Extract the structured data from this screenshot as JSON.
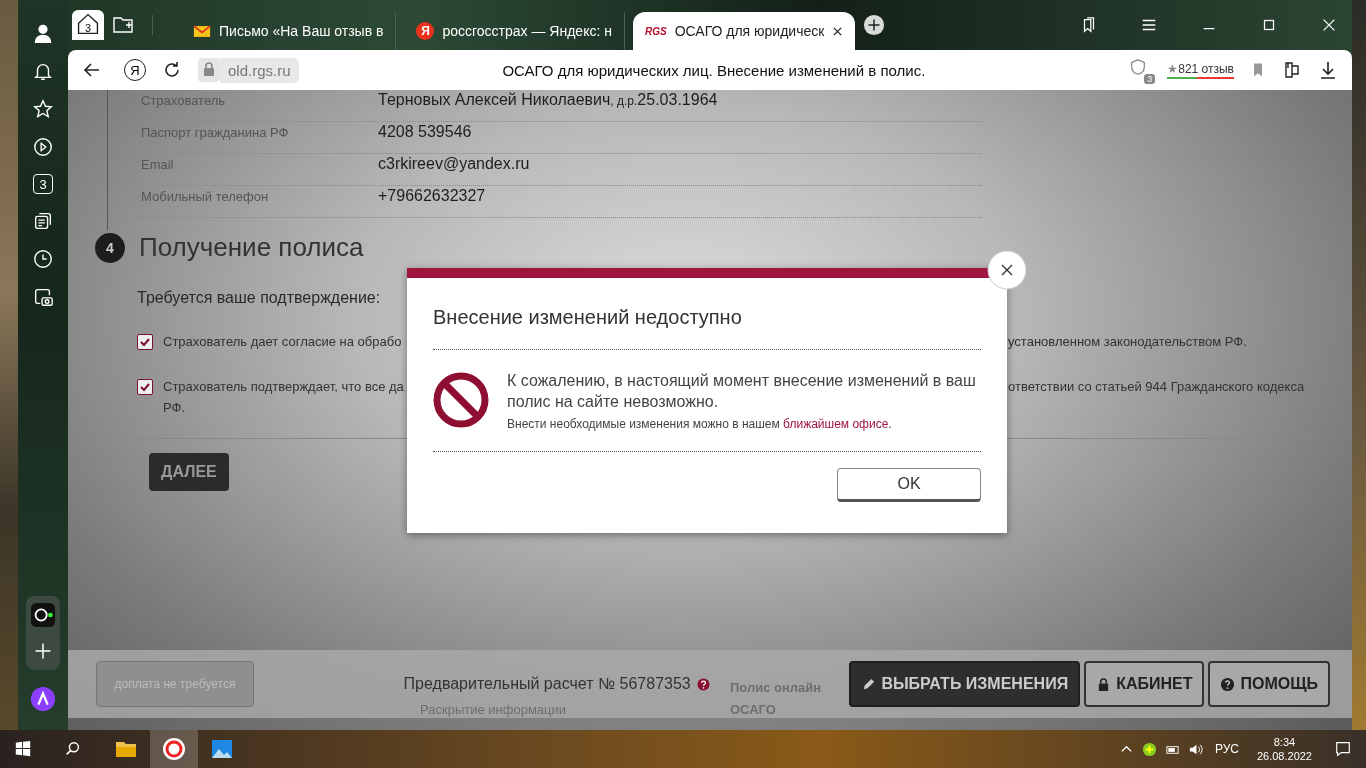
{
  "browser": {
    "home_badge": "3",
    "tabs": [
      {
        "kind": "mail",
        "label": "Письмо «На Ваш отзыв в",
        "selected": false
      },
      {
        "kind": "yandex",
        "icon_text": "Я",
        "label": "россгосстрах — Яндекс: н",
        "selected": false
      },
      {
        "kind": "rgs",
        "icon_text": "RGS",
        "label": "ОСАГО для юридическ",
        "selected": true
      }
    ],
    "yandex_button": "Я",
    "address": "old.rgs.ru",
    "page_title": "ОСАГО для юридических лиц. Внесение изменений в полис.",
    "shield_badge": "3",
    "reviews_star": "★",
    "reviews": "821 отзыв"
  },
  "sidebar": {
    "counter": "3"
  },
  "page": {
    "rows": [
      {
        "label": "Страхователь",
        "value": "Терновых Алексей Николаевич",
        "extra": ", д.р.",
        "extra_value": "25.03.1964"
      },
      {
        "label": "Паспорт гражданина РФ",
        "value": "4208 539546"
      },
      {
        "label": "Email",
        "value": "c3rkireev@yandex.ru"
      },
      {
        "label": "Мобильный телефон",
        "value": "+79662632327"
      }
    ],
    "section": {
      "number": "4",
      "title": "Получение полиса"
    },
    "confirm_prompt": "Требуется ваше подтверждение:",
    "checks": [
      {
        "checked": true,
        "text_start": "Страхователь дает согласие на обрабо",
        "text_end": "установленном законодательством РФ."
      },
      {
        "checked": true,
        "text_start": "Страхователь подтверждает, что все да",
        "text_end": "ответствии со статьей 944 Гражданского кодекса",
        "text_continued": "РФ."
      }
    ],
    "next_button": "ДАЛЕЕ",
    "footer": [
      {
        "text": "Раскрытие информации"
      },
      {
        "text": "Полис онлайн"
      },
      {
        "text": "ОСАГО"
      }
    ]
  },
  "bottom_bar": {
    "surcharge": "доплата не требуется",
    "estimate": "Предварительный расчет № 56787353",
    "buttons": [
      {
        "kind": "pencil",
        "label": "ВЫБРАТЬ ИЗМЕНЕНИЯ"
      },
      {
        "kind": "lock",
        "label": "КАБИНЕТ"
      },
      {
        "kind": "help",
        "label": "ПОМОЩЬ"
      }
    ]
  },
  "dialog": {
    "title": "Внесение изменений недоступно",
    "message": "К сожалению, в настоящий момент внесение изменений в ваш полис на сайте невозможно.",
    "note": "Внести необходимые изменения можно в нашем",
    "note_link": "ближайшем офисе",
    "note_end": ".",
    "ok": "OK"
  },
  "taskbar": {
    "language": "РУС",
    "time": "8:34",
    "date": "26.08.2022"
  }
}
